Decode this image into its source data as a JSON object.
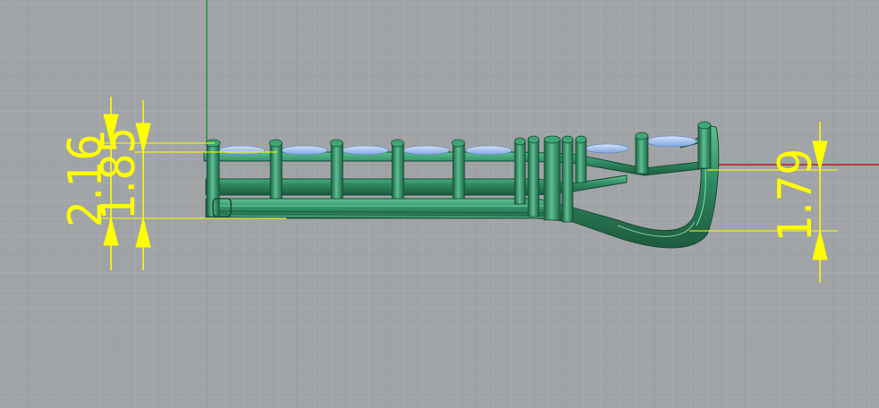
{
  "viewport": {
    "background_color": "#a1a4a7",
    "grid_minor_color": "#aeb1b4",
    "grid_major_color": "#999c9f",
    "x_axis_color": "#b71c1c",
    "y_axis_color": "#1f9a3a"
  },
  "model": {
    "body_color": "#2f8a63",
    "body_dark": "#1f5c40",
    "body_light": "#4fb886",
    "gem_color": "#8fb3e8",
    "gem_light": "#c5daf7"
  },
  "dimensions": {
    "color": "#ffff00",
    "left_outer": {
      "value": "2.16"
    },
    "left_inner": {
      "value": "1.85"
    },
    "right": {
      "value": "1.79"
    }
  }
}
